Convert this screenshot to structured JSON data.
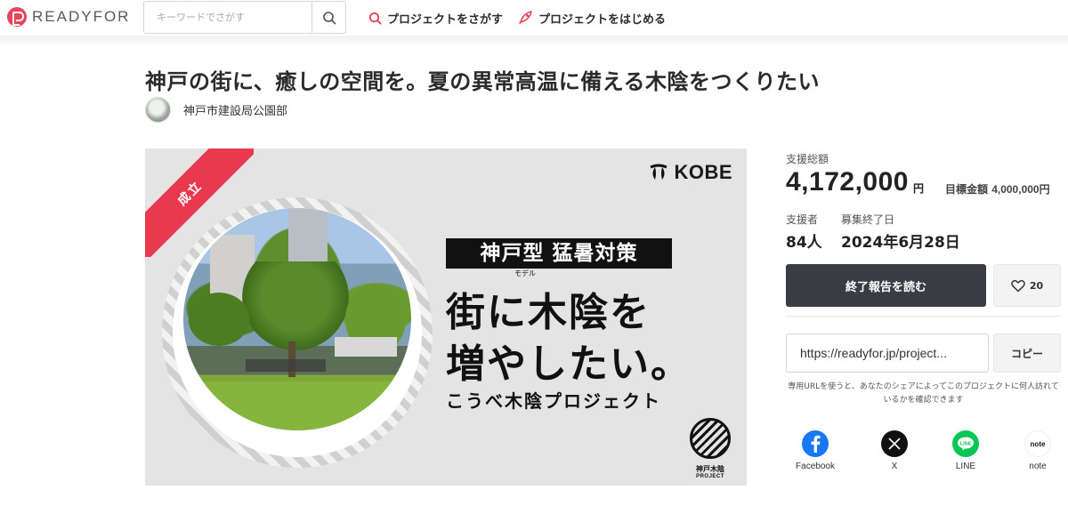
{
  "header": {
    "logo_text": "READYFOR",
    "search_placeholder": "キーワードでさがす",
    "nav_find": "プロジェクトをさがす",
    "nav_start": "プロジェクトをはじめる"
  },
  "project": {
    "title": "神戸の街に、癒しの空間を。夏の異常高温に備える木陰をつくりたい",
    "owner": "神戸市建設局公園部"
  },
  "hero": {
    "ribbon": "成立",
    "kobe_logo": "KOBE",
    "headline_box": "神戸型 猛暑対策",
    "ruby": "モデル",
    "big_line1": "街に木陰を",
    "big_line2": "増やしたい。",
    "subline": "こうべ木陰プロジェクト",
    "project_logo_name": "神戸木陰",
    "project_logo_sub": "PROJECT"
  },
  "stats": {
    "total_label": "支援総額",
    "total_amount": "4,172,000",
    "total_unit": "円",
    "goal_label": "目標金額",
    "goal_amount": "4,000,000円",
    "supporters_label": "支援者",
    "supporters_value": "84人",
    "end_label": "募集終了日",
    "end_value": "2024年6月28日"
  },
  "actions": {
    "report_button": "終了報告を読む",
    "favorite_count": "20",
    "share_url": "https://readyfor.jp/project...",
    "copy_button": "コピー",
    "share_note": "専用URLを使うと、あなたのシェアによってこのプロジェクトに何人訪れているかを確認できます"
  },
  "share": {
    "facebook": "Facebook",
    "x": "X",
    "line": "LINE",
    "note": "note"
  },
  "colors": {
    "brand": "#e8455a",
    "ribbon": "#e8394e",
    "primary_button": "#393c43",
    "facebook": "#1877f2",
    "line": "#06c755"
  }
}
